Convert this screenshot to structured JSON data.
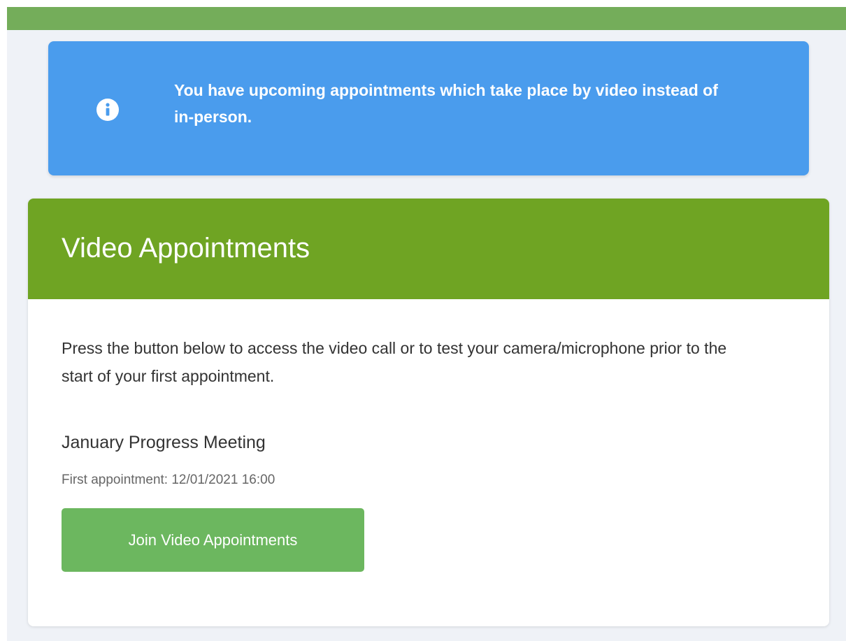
{
  "notice": {
    "icon": "info-circle-icon",
    "message": "You have upcoming appointments which take place by video instead of in-person."
  },
  "card": {
    "title": "Video Appointments",
    "description": "Press the button below to access the video call or to test your camera/microphone prior to the start of your first appointment.",
    "meeting_title": "January Progress Meeting",
    "first_appointment": "First appointment: 12/01/2021 16:00",
    "join_label": "Join Video Appointments"
  },
  "colors": {
    "top_bar": "#74ad5a",
    "page_background": "#eff2f7",
    "notice_background": "#4a9ced",
    "card_header": "#6fa423",
    "join_button": "#6cb75f"
  }
}
